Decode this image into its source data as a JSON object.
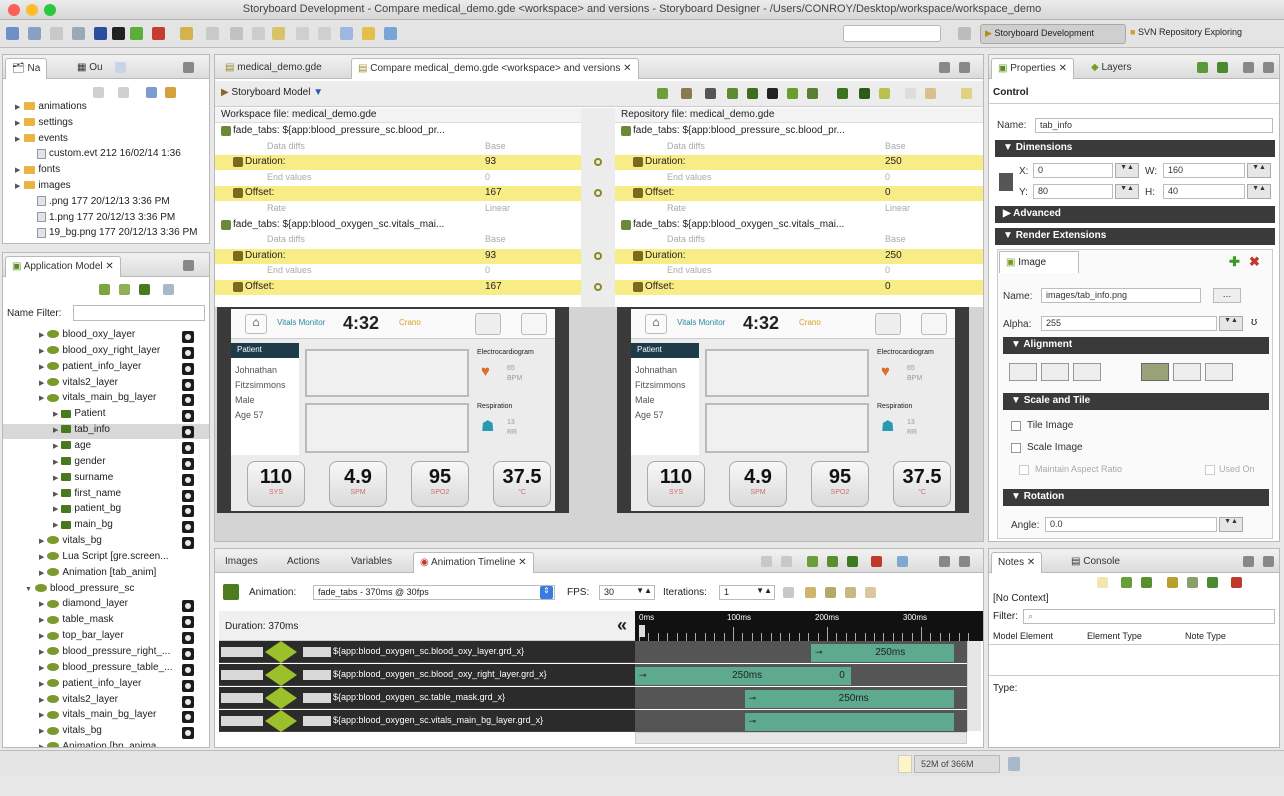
{
  "window": {
    "title": "Storyboard Development - Compare medical_demo.gde <workspace> and versions - Storyboard Designer - /Users/CONROY/Desktop/workspace/workspace_demo"
  },
  "perspectives": {
    "active": "Storyboard Development",
    "other": "SVN Repository Exploring"
  },
  "navigator": {
    "tabs": [
      "Na",
      "Ou"
    ],
    "tree": [
      {
        "label": "animations",
        "type": "folder",
        "depth": 0
      },
      {
        "label": "settings",
        "type": "folder",
        "depth": 0
      },
      {
        "label": "events",
        "type": "folder",
        "depth": 0
      },
      {
        "label": "custom.evt 212  16/02/14 1:36",
        "type": "file",
        "depth": 1
      },
      {
        "label": "fonts",
        "type": "folder",
        "depth": 0
      },
      {
        "label": "images",
        "type": "folder",
        "depth": 0
      },
      {
        "label": ".png 177  20/12/13 3:36 PM",
        "type": "file",
        "depth": 1
      },
      {
        "label": "1.png 177  20/12/13 3:36 PM",
        "type": "file",
        "depth": 1
      },
      {
        "label": "19_bg.png 177  20/12/13 3:36 PM",
        "type": "file",
        "depth": 1
      }
    ]
  },
  "app_model": {
    "title": "Application Model",
    "filter_label": "Name Filter:",
    "items": [
      {
        "label": "blood_oxy_layer",
        "depth": 1
      },
      {
        "label": "blood_oxy_right_layer",
        "depth": 1
      },
      {
        "label": "patient_info_layer",
        "depth": 1
      },
      {
        "label": "vitals2_layer",
        "depth": 1
      },
      {
        "label": "vitals_main_bg_layer",
        "depth": 1
      },
      {
        "label": "Patient",
        "depth": 2
      },
      {
        "label": "tab_info",
        "depth": 2,
        "selected": true
      },
      {
        "label": "age",
        "depth": 2
      },
      {
        "label": "gender",
        "depth": 2
      },
      {
        "label": "surname",
        "depth": 2
      },
      {
        "label": "first_name",
        "depth": 2
      },
      {
        "label": "patient_bg",
        "depth": 2
      },
      {
        "label": "main_bg",
        "depth": 2
      },
      {
        "label": "vitals_bg",
        "depth": 1
      },
      {
        "label": "Lua Script [gre.screen...",
        "depth": 1
      },
      {
        "label": "Animation [tab_anim]",
        "depth": 1
      },
      {
        "label": "blood_pressure_sc",
        "depth": 0
      },
      {
        "label": "diamond_layer",
        "depth": 1
      },
      {
        "label": "table_mask",
        "depth": 1
      },
      {
        "label": "top_bar_layer",
        "depth": 1
      },
      {
        "label": "blood_pressure_right_...",
        "depth": 1
      },
      {
        "label": "blood_pressure_table_...",
        "depth": 1
      },
      {
        "label": "patient_info_layer",
        "depth": 1
      },
      {
        "label": "vitals2_layer",
        "depth": 1
      },
      {
        "label": "vitals_main_bg_layer",
        "depth": 1
      },
      {
        "label": "vitals_bg",
        "depth": 1
      },
      {
        "label": "Animation [bp_anima...",
        "depth": 1
      }
    ]
  },
  "editor": {
    "tabs": [
      "medical_demo.gde",
      "Compare medical_demo.gde <workspace> and versions"
    ],
    "model_label": "Storyboard Model",
    "left_file": "Workspace file: medical_demo.gde",
    "right_file": "Repository file: medical_demo.gde",
    "left_rows": [
      {
        "text": "fade_tabs: ${app:blood_pressure_sc.blood_pr...",
        "kind": "header"
      },
      {
        "text": "Data diffs",
        "val": "Base",
        "kind": "sub"
      },
      {
        "text": "Duration:",
        "val": "93",
        "kind": "hl"
      },
      {
        "text": "End values",
        "val": "0",
        "kind": "sub"
      },
      {
        "text": "Offset:",
        "val": "167",
        "kind": "hl"
      },
      {
        "text": "Rate",
        "val": "Linear",
        "kind": "sub"
      },
      {
        "text": "fade_tabs: ${app:blood_oxygen_sc.vitals_mai...",
        "kind": "header"
      },
      {
        "text": "Data diffs",
        "val": "Base",
        "kind": "sub"
      },
      {
        "text": "Duration:",
        "val": "93",
        "kind": "hl"
      },
      {
        "text": "End values",
        "val": "0",
        "kind": "sub"
      },
      {
        "text": "Offset:",
        "val": "167",
        "kind": "hl"
      }
    ],
    "right_rows": [
      {
        "text": "fade_tabs: ${app:blood_pressure_sc.blood_pr...",
        "kind": "header"
      },
      {
        "text": "Data diffs",
        "val": "Base",
        "kind": "sub"
      },
      {
        "text": "Duration:",
        "val": "250",
        "kind": "hl"
      },
      {
        "text": "End values",
        "val": "0",
        "kind": "sub"
      },
      {
        "text": "Offset:",
        "val": "0",
        "kind": "hl"
      },
      {
        "text": "Rate",
        "val": "Linear",
        "kind": "sub"
      },
      {
        "text": "fade_tabs: ${app:blood_oxygen_sc.vitals_mai...",
        "kind": "header"
      },
      {
        "text": "Data diffs",
        "val": "Base",
        "kind": "sub"
      },
      {
        "text": "Duration:",
        "val": "250",
        "kind": "hl"
      },
      {
        "text": "End values",
        "val": "0",
        "kind": "sub"
      },
      {
        "text": "Offset:",
        "val": "0",
        "kind": "hl"
      }
    ],
    "device": {
      "time": "4:32",
      "vitals_label": "Vitals Monitor",
      "status_label": "Crano",
      "patient_tab": "Patient",
      "patient_lines": [
        "Johnathan",
        "Fitzsimmons",
        "Male",
        "Age 57"
      ],
      "ecg_label": "Electrocardiogram",
      "ecg_values": [
        "65",
        "BPM"
      ],
      "resp_label": "Respiration",
      "resp_values": [
        "13",
        "RR"
      ],
      "vitals": [
        {
          "value": "110",
          "unit": "SYS"
        },
        {
          "value": "4.9",
          "unit": "SPM"
        },
        {
          "value": "95",
          "unit": "SPO2"
        },
        {
          "value": "37.5",
          "unit": "°C"
        }
      ]
    }
  },
  "timeline": {
    "tabs": [
      "Images",
      "Actions",
      "Variables",
      "Animation Timeline"
    ],
    "animation_label": "Animation:",
    "animation_value": "fade_tabs - 370ms @ 30fps",
    "fps_label": "FPS:",
    "fps_value": "30",
    "iterations_label": "Iterations:",
    "iterations_value": "1",
    "duration_label": "Duration: 370ms",
    "ticks": [
      "0ms",
      "100ms",
      "200ms",
      "300ms"
    ],
    "rows": [
      {
        "label": "${app:blood_oxygen_sc.blood_oxy_layer.grd_x}",
        "bar": "250ms"
      },
      {
        "label": "${app:blood_oxygen_sc.blood_oxy_right_layer.grd_x}",
        "bar": "250ms",
        "end": "0"
      },
      {
        "label": "${app:blood_oxygen_sc.table_mask.grd_x}",
        "bar": "250ms"
      },
      {
        "label": "${app:blood_oxygen_sc.vitals_main_bg_layer.grd_x}",
        "bar": ""
      }
    ]
  },
  "properties": {
    "tabs": [
      "Properties",
      "Layers"
    ],
    "context": "Control",
    "name_label": "Name:",
    "name_value": "tab_info",
    "sections": [
      "Dimensions",
      "Advanced",
      "Render Extensions"
    ],
    "x_label": "X:",
    "x_value": "0",
    "y_label": "Y:",
    "y_value": "80",
    "w_label": "W:",
    "w_value": "160",
    "h_label": "H:",
    "h_value": "40",
    "image_tab": "Image",
    "img_name_label": "Name:",
    "img_name_value": "images/tab_info.png",
    "alpha_label": "Alpha:",
    "alpha_value": "255",
    "alignment_label": "Alignment",
    "scale_label": "Scale and Tile",
    "tile_label": "Tile Image",
    "scale_img_label": "Scale Image",
    "aspect_label": "Maintain Aspect Ratio",
    "used_label": "Used On",
    "rotation_label": "Rotation",
    "angle_label": "Angle:",
    "angle_value": "0.0"
  },
  "notes": {
    "tabs": [
      "Notes",
      "Console"
    ],
    "context": "[No Context]",
    "filter_label": "Filter:",
    "columns": [
      "Model Element",
      "Element Type",
      "Note Type"
    ],
    "type_label": "Type:"
  },
  "status": {
    "memory": "52M of 366M"
  }
}
